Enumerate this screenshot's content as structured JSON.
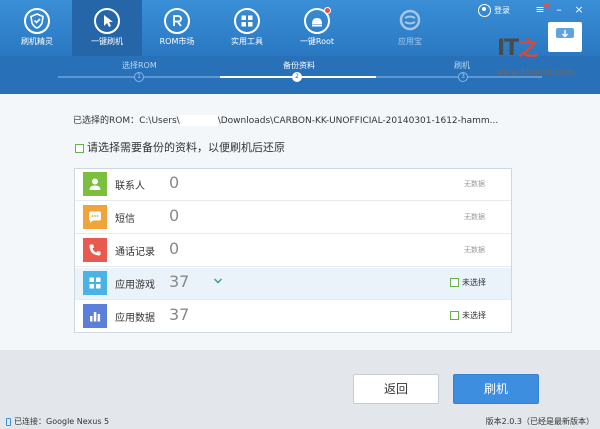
{
  "nav": {
    "items": [
      {
        "label": "刷机精灵"
      },
      {
        "label": "一键刷机"
      },
      {
        "label": "ROM市场"
      },
      {
        "label": "实用工具"
      },
      {
        "label": "一键Root"
      },
      {
        "label": "应用宝"
      }
    ],
    "login_label": "登录"
  },
  "watermark": {
    "brand": "IT",
    "brand_zh": "之",
    "url": "www.ithome.com"
  },
  "steps": [
    {
      "label": "选择ROM",
      "number": "1"
    },
    {
      "label": "备份资料",
      "number": "2"
    },
    {
      "label": "刷机",
      "number": "3"
    }
  ],
  "rom": {
    "prefix": "已选择的ROM：",
    "path_start": "C:\\Users\\",
    "path_end": "\\Downloads\\CARBON-KK-UNOFFICIAL-20140301-1612-hamm..."
  },
  "hint": "请选择需要备份的资料，以便刷机后还原",
  "backup_items": [
    {
      "name": "联系人",
      "count": "0",
      "status": "无数据",
      "color": "#7cbf3f"
    },
    {
      "name": "短信",
      "count": "0",
      "status": "无数据",
      "color": "#f0a43a"
    },
    {
      "name": "通话记录",
      "count": "0",
      "status": "无数据",
      "color": "#e85a4f"
    },
    {
      "name": "应用游戏",
      "count": "37",
      "status": "未选择",
      "color": "#4ab3e6"
    },
    {
      "name": "应用数据",
      "count": "37",
      "status": "未选择",
      "color": "#5b7fdb"
    }
  ],
  "buttons": {
    "back": "返回",
    "flash": "刷机"
  },
  "status": {
    "connection": "已连接：Google Nexus 5",
    "version": "版本2.0.3（已经是最新版本）"
  },
  "colors": {
    "primary": "#2a78c2",
    "accent": "#3e8ee0"
  }
}
